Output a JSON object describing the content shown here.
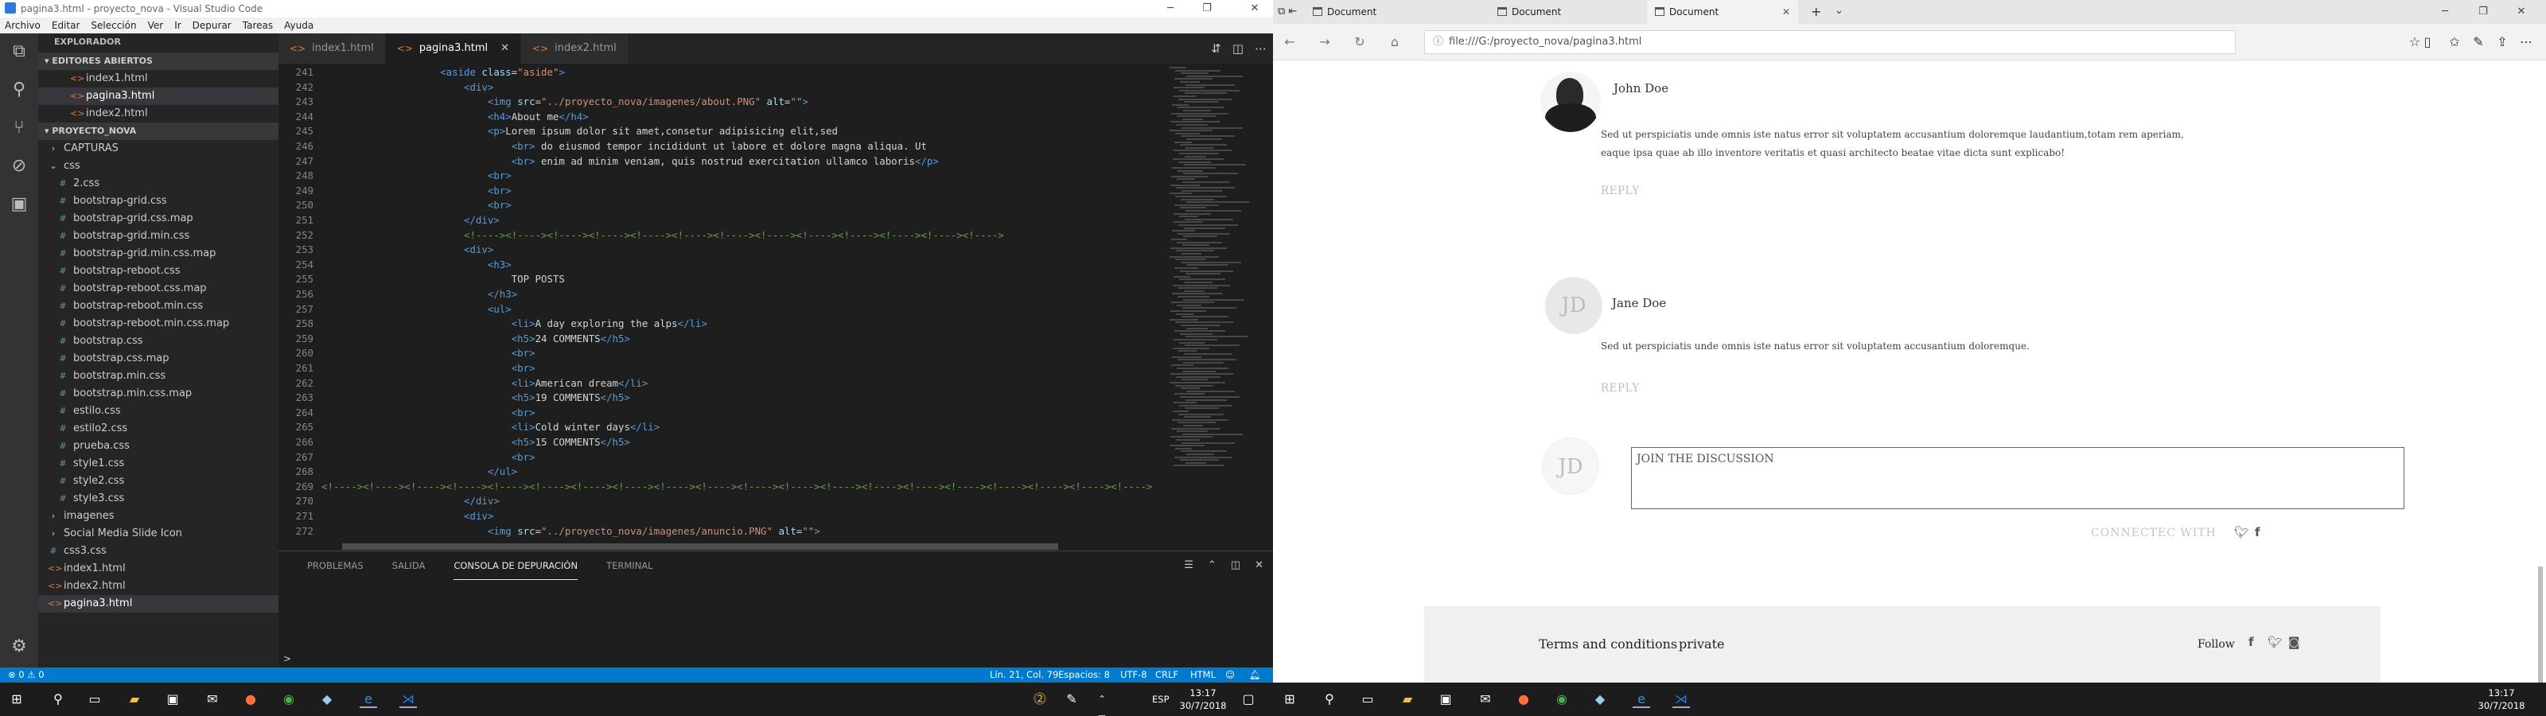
{
  "vscode": {
    "title": "pagina3.html - proyecto_nova - Visual Studio Code",
    "menu": [
      "Archivo",
      "Editar",
      "Selección",
      "Ver",
      "Ir",
      "Depurar",
      "Tareas",
      "Ayuda"
    ],
    "explorer_title": "EXPLORADOR",
    "open_editors_title": "EDITORES ABIERTOS",
    "open_editors": [
      "index1.html",
      "pagina3.html",
      "index2.html"
    ],
    "project_title": "PROYECTO_NOVA",
    "tree": [
      {
        "label": "CAPTURAS",
        "kind": "folder",
        "depth": 1,
        "open": false
      },
      {
        "label": "css",
        "kind": "folder",
        "depth": 1,
        "open": true
      },
      {
        "label": "2.css",
        "kind": "css",
        "depth": 2
      },
      {
        "label": "bootstrap-grid.css",
        "kind": "css",
        "depth": 2
      },
      {
        "label": "bootstrap-grid.css.map",
        "kind": "css",
        "depth": 2
      },
      {
        "label": "bootstrap-grid.min.css",
        "kind": "css",
        "depth": 2
      },
      {
        "label": "bootstrap-grid.min.css.map",
        "kind": "css",
        "depth": 2
      },
      {
        "label": "bootstrap-reboot.css",
        "kind": "css",
        "depth": 2
      },
      {
        "label": "bootstrap-reboot.css.map",
        "kind": "css",
        "depth": 2
      },
      {
        "label": "bootstrap-reboot.min.css",
        "kind": "css",
        "depth": 2
      },
      {
        "label": "bootstrap-reboot.min.css.map",
        "kind": "css",
        "depth": 2
      },
      {
        "label": "bootstrap.css",
        "kind": "css",
        "depth": 2
      },
      {
        "label": "bootstrap.css.map",
        "kind": "css",
        "depth": 2
      },
      {
        "label": "bootstrap.min.css",
        "kind": "css",
        "depth": 2
      },
      {
        "label": "bootstrap.min.css.map",
        "kind": "css",
        "depth": 2
      },
      {
        "label": "estilo.css",
        "kind": "css",
        "depth": 2
      },
      {
        "label": "estilo2.css",
        "kind": "css",
        "depth": 2
      },
      {
        "label": "prueba.css",
        "kind": "css",
        "depth": 2
      },
      {
        "label": "style1.css",
        "kind": "css",
        "depth": 2
      },
      {
        "label": "style2.css",
        "kind": "css",
        "depth": 2
      },
      {
        "label": "style3.css",
        "kind": "css",
        "depth": 2
      },
      {
        "label": "imagenes",
        "kind": "folder",
        "depth": 1,
        "open": false
      },
      {
        "label": "Social Media Slide Icon",
        "kind": "folder",
        "depth": 1,
        "open": false
      },
      {
        "label": "css3.css",
        "kind": "css",
        "depth": 1
      },
      {
        "label": "index1.html",
        "kind": "html",
        "depth": 1
      },
      {
        "label": "index2.html",
        "kind": "html",
        "depth": 1
      },
      {
        "label": "pagina3.html",
        "kind": "html",
        "depth": 1,
        "selected": true
      }
    ],
    "tabs": [
      "index1.html",
      "pagina3.html",
      "index2.html"
    ],
    "active_tab": "pagina3.html",
    "code": [
      {
        "n": "241",
        "i": 10,
        "s": [
          [
            "tg",
            "<aside "
          ],
          [
            "at",
            "class"
          ],
          [
            "tx",
            "="
          ],
          [
            "sv",
            "\"aside\""
          ],
          [
            "tg",
            ">"
          ]
        ]
      },
      {
        "n": "242",
        "i": 12,
        "s": [
          [
            "tg",
            "<div>"
          ]
        ]
      },
      {
        "n": "243",
        "i": 14,
        "s": [
          [
            "tg",
            "<img "
          ],
          [
            "at",
            "src"
          ],
          [
            "tx",
            "="
          ],
          [
            "sv",
            "\"../proyecto_nova/imagenes/about.PNG\""
          ],
          [
            "tx",
            " "
          ],
          [
            "at",
            "alt"
          ],
          [
            "tx",
            "="
          ],
          [
            "sv",
            "\"\""
          ],
          [
            "tg",
            ">"
          ]
        ]
      },
      {
        "n": "244",
        "i": 14,
        "s": [
          [
            "tg",
            "<h4>"
          ],
          [
            "tx",
            "About me"
          ],
          [
            "tg",
            "</h4>"
          ]
        ]
      },
      {
        "n": "245",
        "i": 14,
        "s": [
          [
            "tg",
            "<p>"
          ],
          [
            "tx",
            "Lorem ipsum dolor sit amet,consetur adipisicing elit,sed"
          ]
        ]
      },
      {
        "n": "246",
        "i": 16,
        "s": [
          [
            "tg",
            "<br>"
          ],
          [
            "tx",
            " do eiusmod tempor incididunt ut labore et dolore magna aliqua. Ut"
          ]
        ]
      },
      {
        "n": "247",
        "i": 16,
        "s": [
          [
            "tg",
            "<br>"
          ],
          [
            "tx",
            " enim ad minim veniam, quis nostrud exercitation ullamco laboris"
          ],
          [
            "tg",
            "</p>"
          ]
        ]
      },
      {
        "n": "248",
        "i": 14,
        "s": [
          [
            "tg",
            "<br>"
          ]
        ]
      },
      {
        "n": "249",
        "i": 14,
        "s": [
          [
            "tg",
            "<br>"
          ]
        ]
      },
      {
        "n": "250",
        "i": 14,
        "s": [
          [
            "tg",
            "<br>"
          ]
        ]
      },
      {
        "n": "251",
        "i": 12,
        "s": [
          [
            "tg",
            "</div>"
          ]
        ]
      },
      {
        "n": "252",
        "i": 12,
        "s": [
          [
            "cm",
            "<!----><!----><!----><!----><!----><!----><!----><!----><!----><!----><!----><!----><!---->"
          ]
        ]
      },
      {
        "n": "253",
        "i": 12,
        "s": [
          [
            "tg",
            "<div>"
          ]
        ]
      },
      {
        "n": "254",
        "i": 14,
        "s": [
          [
            "tg",
            "<h3>"
          ]
        ]
      },
      {
        "n": "255",
        "i": 16,
        "s": [
          [
            "tx",
            "TOP POSTS"
          ]
        ]
      },
      {
        "n": "256",
        "i": 14,
        "s": [
          [
            "tg",
            "</h3>"
          ]
        ]
      },
      {
        "n": "257",
        "i": 14,
        "s": [
          [
            "tg",
            "<ul>"
          ]
        ]
      },
      {
        "n": "258",
        "i": 16,
        "s": [
          [
            "tg",
            "<li>"
          ],
          [
            "tx",
            "A day exploring the alps"
          ],
          [
            "tg",
            "</li>"
          ]
        ]
      },
      {
        "n": "259",
        "i": 16,
        "s": [
          [
            "tg",
            "<h5>"
          ],
          [
            "tx",
            "24 COMMENTS"
          ],
          [
            "tg",
            "</h5>"
          ]
        ]
      },
      {
        "n": "260",
        "i": 16,
        "s": [
          [
            "tg",
            "<br>"
          ]
        ]
      },
      {
        "n": "261",
        "i": 16,
        "s": [
          [
            "tg",
            "<br>"
          ]
        ]
      },
      {
        "n": "262",
        "i": 16,
        "s": [
          [
            "tg",
            "<li>"
          ],
          [
            "tx",
            "American dream"
          ],
          [
            "tg",
            "</li>"
          ]
        ]
      },
      {
        "n": "263",
        "i": 16,
        "s": [
          [
            "tg",
            "<h5>"
          ],
          [
            "tx",
            "19 COMMENTS"
          ],
          [
            "tg",
            "</h5>"
          ]
        ]
      },
      {
        "n": "264",
        "i": 16,
        "s": [
          [
            "tg",
            "<br>"
          ]
        ]
      },
      {
        "n": "265",
        "i": 16,
        "s": [
          [
            "tg",
            "<li>"
          ],
          [
            "tx",
            "Cold winter days"
          ],
          [
            "tg",
            "</li>"
          ]
        ]
      },
      {
        "n": "266",
        "i": 16,
        "s": [
          [
            "tg",
            "<h5>"
          ],
          [
            "tx",
            "15 COMMENTS"
          ],
          [
            "tg",
            "</h5>"
          ]
        ]
      },
      {
        "n": "267",
        "i": 16,
        "s": [
          [
            "tg",
            "<br>"
          ]
        ]
      },
      {
        "n": "268",
        "i": 14,
        "s": [
          [
            "tg",
            "</ul>"
          ]
        ]
      },
      {
        "n": "269",
        "i": 0,
        "s": [
          [
            "cm",
            "<!----><!----><!----><!----><!----><!----><!----><!----><!----><!----><!----><!----><!----><!----><!----><!----><!----><!----><!----><!---->"
          ]
        ]
      },
      {
        "n": "270",
        "i": 12,
        "s": [
          [
            "tg",
            "</div>"
          ]
        ]
      },
      {
        "n": "271",
        "i": 12,
        "s": [
          [
            "tg",
            "<div>"
          ]
        ]
      },
      {
        "n": "272",
        "i": 14,
        "s": [
          [
            "tg",
            "<img "
          ],
          [
            "at",
            "src"
          ],
          [
            "tx",
            "="
          ],
          [
            "sv",
            "\"../proyecto_nova/imagenes/anuncio.PNG\""
          ],
          [
            "tx",
            " "
          ],
          [
            "at",
            "alt"
          ],
          [
            "tx",
            "="
          ],
          [
            "sv",
            "\"\""
          ],
          [
            "tg",
            ">"
          ]
        ]
      }
    ],
    "panel_tabs": [
      "PROBLEMAS",
      "SALIDA",
      "CONSOLA DE DEPURACIÓN",
      "TERMINAL"
    ],
    "panel_active": "CONSOLA DE DEPURACIÓN",
    "panel_prompt": ">",
    "status": {
      "errors": "0",
      "warnings": "0",
      "position": "Lín. 21, Col. 79",
      "spaces": "Espacios: 8",
      "encoding": "UTF-8",
      "eol": "CRLF",
      "language": "HTML",
      "badge": "1"
    }
  },
  "edge": {
    "tabs": [
      "Document",
      "Document",
      "Document"
    ],
    "active_tab_index": 2,
    "url": "file:///G:/proyecto_nova/pagina3.html",
    "comments": [
      {
        "name": "John Doe",
        "text1": "Sed ut perspiciatis unde omnis iste natus error sit voluptatem accusantium doloremque laudantium,totam rem aperiam,",
        "text2": "eaque ipsa quae ab illo inventore veritatis et quasi architecto beatae vitae dicta sunt explicabo!",
        "reply": "REPLY"
      },
      {
        "name": "Jane Doe",
        "initials": "JD",
        "text1": "Sed ut perspiciatis unde omnis iste natus error sit voluptatem accusantium doloremque.",
        "reply": "REPLY"
      }
    ],
    "discussion_initials": "JD",
    "discussion_placeholder": "JOIN THE DISCUSSION",
    "connect_label": "CONNECTEC WITH",
    "footer": {
      "terms": "Terms and conditions",
      "private": "private",
      "follow": "Follow"
    }
  },
  "taskbar_left": {
    "lang": "ESP",
    "time": "13:17",
    "date": "30/7/2018"
  },
  "taskbar_right": {
    "time": "13:17",
    "date": "30/7/2018"
  },
  "colors": {
    "vs_accent": "#007acc",
    "edge_bg": "#ffffff",
    "footer_bg": "#f0f0f0"
  }
}
